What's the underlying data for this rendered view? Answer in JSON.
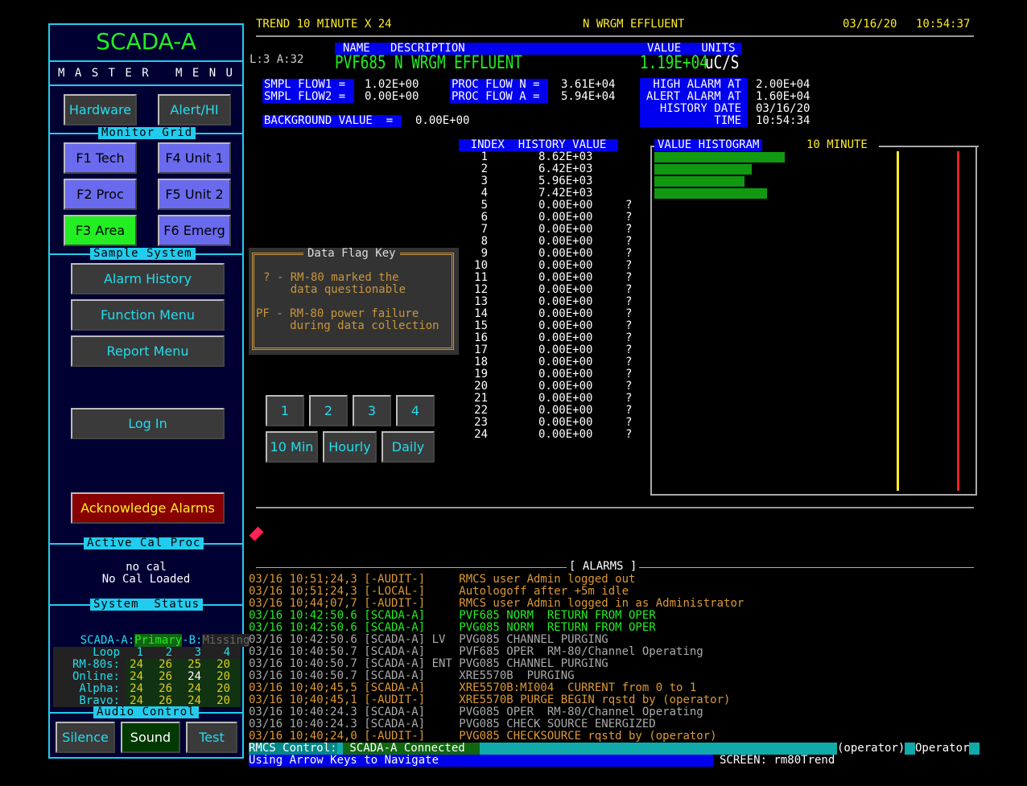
{
  "sidebar": {
    "title": "SCADA-A",
    "master_menu": "M A S T E R   M E N U",
    "hardware": "Hardware",
    "alert": "Alert/HI",
    "monitor_grid": "Monitor Grid",
    "f1": "F1 Tech",
    "f4": "F4 Unit 1",
    "f2": "F2 Proc",
    "f5": "F5 Unit 2",
    "f3": "F3 Area",
    "f6": "F6 Emerg",
    "sample_system": "Sample System",
    "alarm_history": "Alarm History",
    "function_menu": "Function Menu",
    "report_menu": "Report Menu",
    "log_in": "Log In",
    "ack_alarms": "Acknowledge Alarms",
    "active_cal": "Active Cal Proc",
    "cal_line1": "no cal",
    "cal_line2": "No Cal Loaded",
    "system_status": "System  Status",
    "scada_a_label": "SCADA-A:",
    "primary": "Primary",
    "b_label": "-B:",
    "missing": "Missing",
    "loop_table": {
      "rows": [
        {
          "label": "Loop",
          "vals": [
            "1",
            "2",
            "3",
            "4"
          ]
        },
        {
          "label": "RM-80s:",
          "vals": [
            "24",
            "26",
            "25",
            "20"
          ]
        },
        {
          "label": "Online:",
          "vals": [
            "24",
            "26",
            "24",
            "20"
          ]
        },
        {
          "label": "Alpha:",
          "vals": [
            "24",
            "26",
            "24",
            "20"
          ]
        },
        {
          "label": "Bravo:",
          "vals": [
            "24",
            "26",
            "24",
            "20"
          ]
        }
      ]
    },
    "audio_control": "Audio Control",
    "silence": "Silence",
    "sound": "Sound",
    "test": "Test"
  },
  "header": {
    "left": "TREND 10 MINUTE X 24",
    "center": "N WRGM EFFLUENT",
    "date": "03/16/20",
    "time": "10:54:37"
  },
  "info": {
    "la": "L:3 A:32",
    "col_name_desc": "NAME   DESCRIPTION",
    "col_value_units": "VALUE   UNITS",
    "name": "PVF685",
    "desc": "N WRGM EFFLUENT",
    "value": "1.19E+04",
    "units": "uC/S",
    "smpl1_label": "SMPL FLOW1 = ",
    "smpl1_val": "1.02E+00",
    "smpl2_label": "SMPL FLOW2 = ",
    "smpl2_val": "0.00E+00",
    "procn_label": "PROC FLOW N = ",
    "procn_val": "3.61E+04",
    "proca_label": "PROC FLOW A = ",
    "proca_val": "5.94E+04",
    "high_label": "HIGH ALARM AT",
    "high_val": "2.00E+04",
    "alert_label": "ALERT ALARM AT",
    "alert_val": "1.60E+04",
    "hdate_label": "HISTORY DATE",
    "hdate_val": "03/16/20",
    "time_label": "TIME",
    "time_val": "10:54:34",
    "bg_label": "BACKGROUND VALUE  = ",
    "bg_val": "0.00E+00"
  },
  "history": {
    "header": "INDEX  HISTORY VALUE",
    "rows": [
      {
        "i": "1",
        "v": "8.62E+03",
        "f": ""
      },
      {
        "i": "2",
        "v": "6.42E+03",
        "f": ""
      },
      {
        "i": "3",
        "v": "5.96E+03",
        "f": ""
      },
      {
        "i": "4",
        "v": "7.42E+03",
        "f": ""
      },
      {
        "i": "5",
        "v": "0.00E+00",
        "f": "?"
      },
      {
        "i": "6",
        "v": "0.00E+00",
        "f": "?"
      },
      {
        "i": "7",
        "v": "0.00E+00",
        "f": "?"
      },
      {
        "i": "8",
        "v": "0.00E+00",
        "f": "?"
      },
      {
        "i": "9",
        "v": "0.00E+00",
        "f": "?"
      },
      {
        "i": "10",
        "v": "0.00E+00",
        "f": "?"
      },
      {
        "i": "11",
        "v": "0.00E+00",
        "f": "?"
      },
      {
        "i": "12",
        "v": "0.00E+00",
        "f": "?"
      },
      {
        "i": "13",
        "v": "0.00E+00",
        "f": "?"
      },
      {
        "i": "14",
        "v": "0.00E+00",
        "f": "?"
      },
      {
        "i": "15",
        "v": "0.00E+00",
        "f": "?"
      },
      {
        "i": "16",
        "v": "0.00E+00",
        "f": "?"
      },
      {
        "i": "17",
        "v": "0.00E+00",
        "f": "?"
      },
      {
        "i": "18",
        "v": "0.00E+00",
        "f": "?"
      },
      {
        "i": "19",
        "v": "0.00E+00",
        "f": "?"
      },
      {
        "i": "20",
        "v": "0.00E+00",
        "f": "?"
      },
      {
        "i": "21",
        "v": "0.00E+00",
        "f": "?"
      },
      {
        "i": "22",
        "v": "0.00E+00",
        "f": "?"
      },
      {
        "i": "23",
        "v": "0.00E+00",
        "f": "?"
      },
      {
        "i": "24",
        "v": "0.00E+00",
        "f": "?"
      }
    ]
  },
  "flag_key": {
    "title": "Data Flag Key",
    "l1": "? - RM-80 marked the",
    "l2": "    data questionable",
    "l3": "PF - RM-80 power failure",
    "l4": "     during data collection"
  },
  "trend_buttons": [
    "1",
    "2",
    "3",
    "4"
  ],
  "range_buttons": [
    "10 Min",
    "Hourly",
    "Daily"
  ],
  "histogram": {
    "title": "VALUE HISTOGRAM",
    "period": "10 MINUTE"
  },
  "chart_data": {
    "type": "bar",
    "categories": [
      "1",
      "2",
      "3",
      "4"
    ],
    "values": [
      8620,
      6420,
      5960,
      7420
    ],
    "xlim": [
      0,
      21000
    ],
    "reference_lines": [
      {
        "value": 16000,
        "color": "#ffee22"
      },
      {
        "value": 20000,
        "color": "#ee2222"
      }
    ]
  },
  "alarms": {
    "title": "[ ALARMS ]",
    "rows": [
      {
        "t": "03/16 10;51;24,3 [-AUDIT-]     RMCS user Admin logged out",
        "c": "#dd9933"
      },
      {
        "t": "03/16 10;51;24,3 [-LOCAL-]     Autologoff after +5m idle",
        "c": "#dd9933"
      },
      {
        "t": "03/16 10;44;07,7 [-AUDIT-]     RMCS user Admin logged in as Administrator",
        "c": "#dd9933"
      },
      {
        "t": "03/16 10:42:50.6 [SCADA-A]     PVF685 NORM  RETURN FROM OPER",
        "c": "#22ee22"
      },
      {
        "t": "03/16 10:42:50.6 [SCADA-A]     PVG085 NORM  RETURN FROM OPER",
        "c": "#22ee22"
      },
      {
        "t": "03/16 10:42:50.6 [SCADA-A] LV  PVG085 CHANNEL PURGING",
        "c": "#aaaaaa"
      },
      {
        "t": "03/16 10:40:50.7 [SCADA-A]     PVF685 OPER  RM-80/Channel Operating",
        "c": "#aaaaaa"
      },
      {
        "t": "03/16 10:40:50.7 [SCADA-A] ENT PVG085 CHANNEL PURGING",
        "c": "#aaaaaa"
      },
      {
        "t": "03/16 10:40:50.7 [SCADA-A]     XRE5570B  PURGING",
        "c": "#aaaaaa"
      },
      {
        "t": "03/16 10;40;45,5 [SCADA-A]     XRE5570B:MI004  CURRENT from 0 to 1",
        "c": "#dd9933"
      },
      {
        "t": "03/16 10;40;45,1 [-AUDIT-]     XRE5570B PURGE BEGIN rqstd by (operator)",
        "c": "#dd9933"
      },
      {
        "t": "03/16 10:40:24.3 [SCADA-A]     PVG085 OPER  RM-80/Channel Operating",
        "c": "#aaaaaa"
      },
      {
        "t": "03/16 10:40:24.3 [SCADA-A]     PVG085 CHECK SOURCE ENERGIZED",
        "c": "#aaaaaa"
      },
      {
        "t": "03/16 10;40;24,0 [-AUDIT-]     PVG085 CHECKSOURCE rqstd by (operator)",
        "c": "#dd9933"
      }
    ]
  },
  "status_bar": {
    "rmcs_label": "RMCS Control:",
    "rmcs_value": " SCADA-A Connected",
    "operator_paren": "(operator)",
    "operator": "Operator",
    "nav": "Using Arrow Keys to Navigate",
    "screen": "SCREEN: rm80Trend"
  }
}
